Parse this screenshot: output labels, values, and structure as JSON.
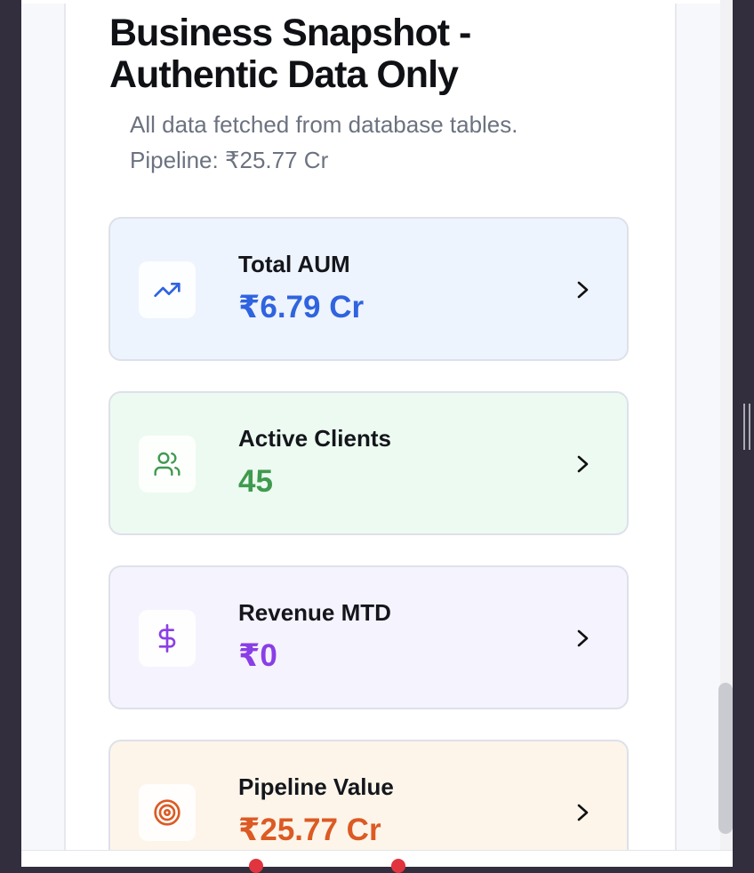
{
  "header": {
    "title": "Business Snapshot - Authentic Data Only",
    "subtitle_line1": "All data fetched from database tables.",
    "subtitle_line2": "Pipeline: ₹25.77 Cr"
  },
  "cards": [
    {
      "label": "Total AUM",
      "value": "₹6.79 Cr",
      "icon": "trending-up-icon",
      "accent": "#2f63e0",
      "bg": "#eef4fd"
    },
    {
      "label": "Active Clients",
      "value": "45",
      "icon": "users-icon",
      "accent": "#3f9a4f",
      "bg": "#edfaf1"
    },
    {
      "label": "Revenue MTD",
      "value": "₹0",
      "icon": "dollar-sign-icon",
      "accent": "#8a3ee6",
      "bg": "#f5f3fe"
    },
    {
      "label": "Pipeline Value",
      "value": "₹25.77 Cr",
      "icon": "target-icon",
      "accent": "#dc5a24",
      "bg": "#fdf5ea"
    }
  ],
  "colors": {
    "title": "#0f1115",
    "subtitle": "#6c7280",
    "window_frame": "#322e3e"
  }
}
